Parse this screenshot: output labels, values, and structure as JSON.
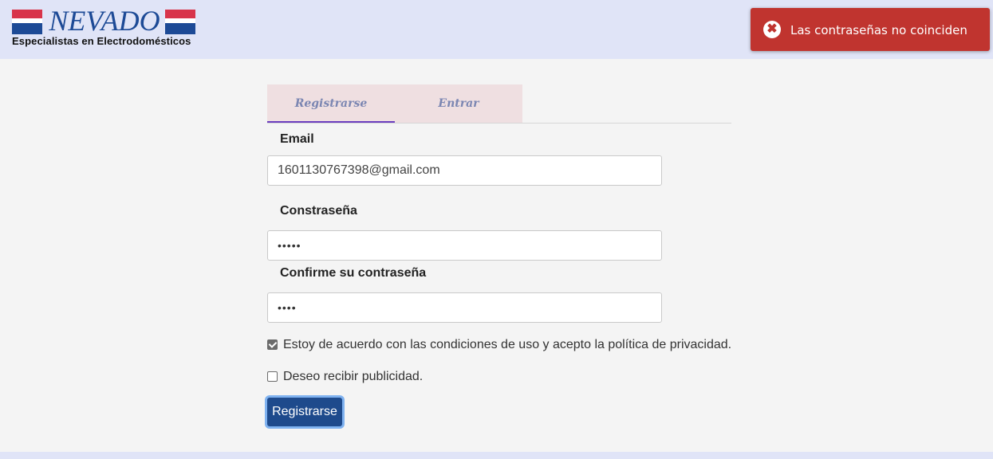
{
  "header": {
    "logo_brand": "NEVADO",
    "logo_tagline": "Especialistas en Electrodomésticos"
  },
  "toast": {
    "icon": "close-circle-icon",
    "message": "Las contraseñas no coinciden",
    "color": "#c0342f"
  },
  "tabs": [
    {
      "label": "Registrarse",
      "active": true
    },
    {
      "label": "Entrar",
      "active": false
    }
  ],
  "form": {
    "email_label": "Email",
    "email_value": "1601130767398@gmail.com",
    "password_label": "Constraseña",
    "password_value": "•••••",
    "confirm_label": "Confirme su contraseña",
    "confirm_value": "••••",
    "terms_label": "Estoy de acuerdo con las condiciones de uso y acepto la política de privacidad.",
    "terms_checked": true,
    "ads_label": "Deseo recibir publicidad.",
    "ads_checked": false,
    "submit_label": "Registrarse"
  }
}
